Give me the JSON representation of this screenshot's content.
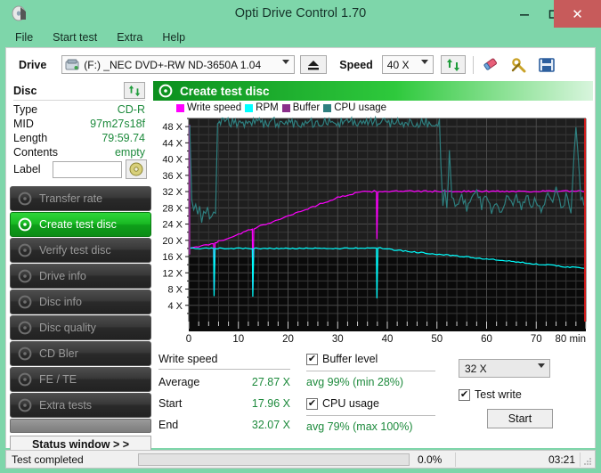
{
  "window": {
    "title": "Opti Drive Control 1.70",
    "icon": "disc-icon",
    "controls": {
      "minimize": "–",
      "maximize": "❑",
      "close": "✕"
    }
  },
  "menu": {
    "items": [
      {
        "label": "File"
      },
      {
        "label": "Start test"
      },
      {
        "label": "Extra"
      },
      {
        "label": "Help"
      }
    ]
  },
  "toolbar": {
    "drive_label": "Drive",
    "drive_value": "(F:)  _NEC DVD+-RW ND-3650A 1.04",
    "eject_icon": "eject-icon",
    "speed_label": "Speed",
    "speed_value": "40 X",
    "refresh_icon": "refresh-icon",
    "eraser_icon": "eraser-icon",
    "tools_icon": "tools-icon",
    "save_icon": "save-icon"
  },
  "disc": {
    "header": "Disc",
    "refresh_icon": "refresh-icon",
    "rows": [
      {
        "key": "Type",
        "value": "CD-R"
      },
      {
        "key": "MID",
        "value": "97m27s18f"
      },
      {
        "key": "Length",
        "value": "79:59.74"
      },
      {
        "key": "Contents",
        "value": "empty"
      }
    ],
    "label_key": "Label",
    "label_value": "",
    "label_placeholder": "",
    "label_button_icon": "disc-icon"
  },
  "sidebar": {
    "items": [
      {
        "label": "Transfer rate",
        "icon": "disc-test-icon",
        "active": false
      },
      {
        "label": "Create test disc",
        "icon": "disc-test-icon",
        "active": true
      },
      {
        "label": "Verify test disc",
        "icon": "disc-test-icon",
        "active": false
      },
      {
        "label": "Drive info",
        "icon": "disc-test-icon",
        "active": false
      },
      {
        "label": "Disc info",
        "icon": "disc-test-icon",
        "active": false
      },
      {
        "label": "Disc quality",
        "icon": "disc-test-icon",
        "active": false
      },
      {
        "label": "CD Bler",
        "icon": "disc-test-icon",
        "active": false
      },
      {
        "label": "FE / TE",
        "icon": "disc-test-icon",
        "active": false
      },
      {
        "label": "Extra tests",
        "icon": "disc-test-icon",
        "active": false
      }
    ],
    "status_window_label": "Status window > >"
  },
  "section": {
    "icon": "disc-test-icon",
    "title": "Create test disc"
  },
  "chart_data": {
    "type": "line",
    "title": "Create test disc",
    "xlabel": "min",
    "ylabel": "X",
    "xlim": [
      0,
      80
    ],
    "ylim": [
      0,
      50
    ],
    "xticks": [
      0,
      10,
      20,
      30,
      40,
      50,
      60,
      70,
      80
    ],
    "xticklabels": [
      "0",
      "10",
      "20",
      "30",
      "40",
      "50",
      "60",
      "70",
      "80 min"
    ],
    "yticks": [
      4,
      8,
      12,
      16,
      20,
      24,
      28,
      32,
      36,
      40,
      44,
      48
    ],
    "yticklabels": [
      "4 X",
      "8 X",
      "12 X",
      "16 X",
      "20 X",
      "24 X",
      "28 X",
      "32 X",
      "36 X",
      "40 X",
      "44 X",
      "48 X"
    ],
    "grid": true,
    "legend_position": "top-left",
    "background": "#1e1e1e",
    "lower_background": "#0a0a0a",
    "grid_color": "#4a4a4a",
    "series": [
      {
        "name": "Write speed",
        "color": "#ff00ff",
        "points": [
          [
            0,
            17.96
          ],
          [
            1,
            18.1
          ],
          [
            2,
            18.4
          ],
          [
            3,
            18.7
          ],
          [
            4,
            19.0
          ],
          [
            5,
            19.3
          ],
          [
            5.1,
            7.8
          ],
          [
            5.3,
            19.4
          ],
          [
            6,
            19.7
          ],
          [
            8,
            20.6
          ],
          [
            10,
            21.5
          ],
          [
            12,
            22.4
          ],
          [
            12.8,
            22.8
          ],
          [
            12.9,
            7.6
          ],
          [
            13.1,
            22.9
          ],
          [
            14,
            23.3
          ],
          [
            16,
            24.2
          ],
          [
            18,
            25.1
          ],
          [
            20,
            26.0
          ],
          [
            22,
            26.9
          ],
          [
            24,
            27.8
          ],
          [
            26,
            28.7
          ],
          [
            28,
            29.6
          ],
          [
            30,
            30.5
          ],
          [
            32,
            31.2
          ],
          [
            34,
            31.7
          ],
          [
            36,
            32.0
          ],
          [
            37.8,
            32.07
          ],
          [
            37.9,
            20.2
          ],
          [
            38.1,
            32.07
          ],
          [
            40,
            32.07
          ],
          [
            50,
            32.07
          ],
          [
            60,
            32.07
          ],
          [
            70,
            32.07
          ],
          [
            79.9,
            32.07
          ]
        ]
      },
      {
        "name": "RPM",
        "color": "#00ffff",
        "points": [
          [
            0,
            18.0
          ],
          [
            5,
            18.0
          ],
          [
            5.1,
            6.3
          ],
          [
            5.3,
            18.0
          ],
          [
            10,
            18.0
          ],
          [
            12.8,
            18.0
          ],
          [
            12.9,
            6.2
          ],
          [
            13.1,
            18.0
          ],
          [
            20,
            18.0
          ],
          [
            30,
            18.0
          ],
          [
            37.8,
            18.2
          ],
          [
            37.9,
            5.8
          ],
          [
            38.1,
            18.2
          ],
          [
            40,
            17.8
          ],
          [
            45,
            17.2
          ],
          [
            50,
            16.6
          ],
          [
            55,
            16.0
          ],
          [
            60,
            15.4
          ],
          [
            65,
            14.8
          ],
          [
            70,
            14.2
          ],
          [
            75,
            13.6
          ],
          [
            79.9,
            13.1
          ]
        ]
      },
      {
        "name": "Buffer",
        "color": "#8b2f8b",
        "description": "vertical buffer-level trace at start of burn",
        "points": [
          [
            0.15,
            48.5
          ],
          [
            0.15,
            16.5
          ]
        ]
      },
      {
        "name": "CPU usage",
        "color": "#2e7f7f",
        "description": "noisy CPU usage trace, spikes to 100%",
        "points": [
          [
            0.2,
            49
          ],
          [
            0.6,
            29.5
          ],
          [
            1.0,
            26.5
          ],
          [
            1.4,
            28.0
          ],
          [
            1.8,
            25.8
          ],
          [
            2.2,
            27.4
          ],
          [
            2.6,
            25.4
          ],
          [
            3.0,
            27.0
          ],
          [
            3.4,
            25.6
          ],
          [
            3.8,
            27.2
          ],
          [
            4.2,
            25.9
          ],
          [
            4.6,
            26.4
          ],
          [
            5.0,
            26.0
          ],
          [
            5.4,
            26.2
          ],
          [
            5.8,
            49
          ],
          [
            6.2,
            49
          ],
          [
            6.4,
            49
          ],
          [
            50.5,
            49
          ],
          [
            50.8,
            38.5
          ],
          [
            51.2,
            29.4
          ],
          [
            51.6,
            33.5
          ],
          [
            52.0,
            27.8
          ],
          [
            52.5,
            41.0
          ],
          [
            53.0,
            30.2
          ],
          [
            54.0,
            28.5
          ],
          [
            55.0,
            31.0
          ],
          [
            56.0,
            27.4
          ],
          [
            57.0,
            29.8
          ],
          [
            58.0,
            33.4
          ],
          [
            59.0,
            28.2
          ],
          [
            60.0,
            30.5
          ],
          [
            61.0,
            27.0
          ],
          [
            62.0,
            29.0
          ],
          [
            63.0,
            26.8
          ],
          [
            64.0,
            31.5
          ],
          [
            65.0,
            28.4
          ],
          [
            66.0,
            30.8
          ],
          [
            67.0,
            27.6
          ],
          [
            68.0,
            32.0
          ],
          [
            69.0,
            28.8
          ],
          [
            70.0,
            30.0
          ],
          [
            71.0,
            27.2
          ],
          [
            72.0,
            31.2
          ],
          [
            73.0,
            29.4
          ],
          [
            74.0,
            33.0
          ],
          [
            75.0,
            28.0
          ],
          [
            76.0,
            30.6
          ],
          [
            77.0,
            27.8
          ],
          [
            78.0,
            49
          ],
          [
            79.0,
            30.0
          ],
          [
            79.6,
            28.6
          ]
        ]
      }
    ],
    "end_marker": {
      "x": 80,
      "color": "#d01a1a"
    },
    "legend": [
      {
        "label": "Write speed",
        "color": "#ff00ff"
      },
      {
        "label": "RPM",
        "color": "#00ffff"
      },
      {
        "label": "Buffer",
        "color": "#8b2f8b"
      },
      {
        "label": "CPU usage",
        "color": "#2e7f7f"
      }
    ]
  },
  "stats": {
    "write_speed_title": "Write speed",
    "rows": [
      {
        "key": "Average",
        "value": "27.87 X"
      },
      {
        "key": "Start",
        "value": "17.96 X"
      },
      {
        "key": "End",
        "value": "32.07 X"
      }
    ],
    "buffer_level": {
      "label": "Buffer level",
      "checked": true,
      "summary": "avg 99% (min 28%)"
    },
    "cpu_usage": {
      "label": "CPU usage",
      "checked": true,
      "summary": "avg 79% (max 100%)"
    }
  },
  "controls": {
    "write_speed_value": "32 X",
    "test_write": {
      "label": "Test write",
      "checked": true
    },
    "start_label": "Start",
    "check_glyph": "✔"
  },
  "statusbar": {
    "text": "Test completed",
    "progress_percent": "0.0%",
    "progress_value": 0,
    "elapsed": "03:21"
  },
  "colors": {
    "window_chrome": "#7ed6aa",
    "close_button": "#c75b5b",
    "accent_green": "#1d8a3c",
    "active_nav": "#18b822",
    "write_speed": "#ff00ff",
    "rpm": "#00ffff",
    "buffer": "#8b2f8b",
    "cpu_usage": "#2e7f7f"
  }
}
